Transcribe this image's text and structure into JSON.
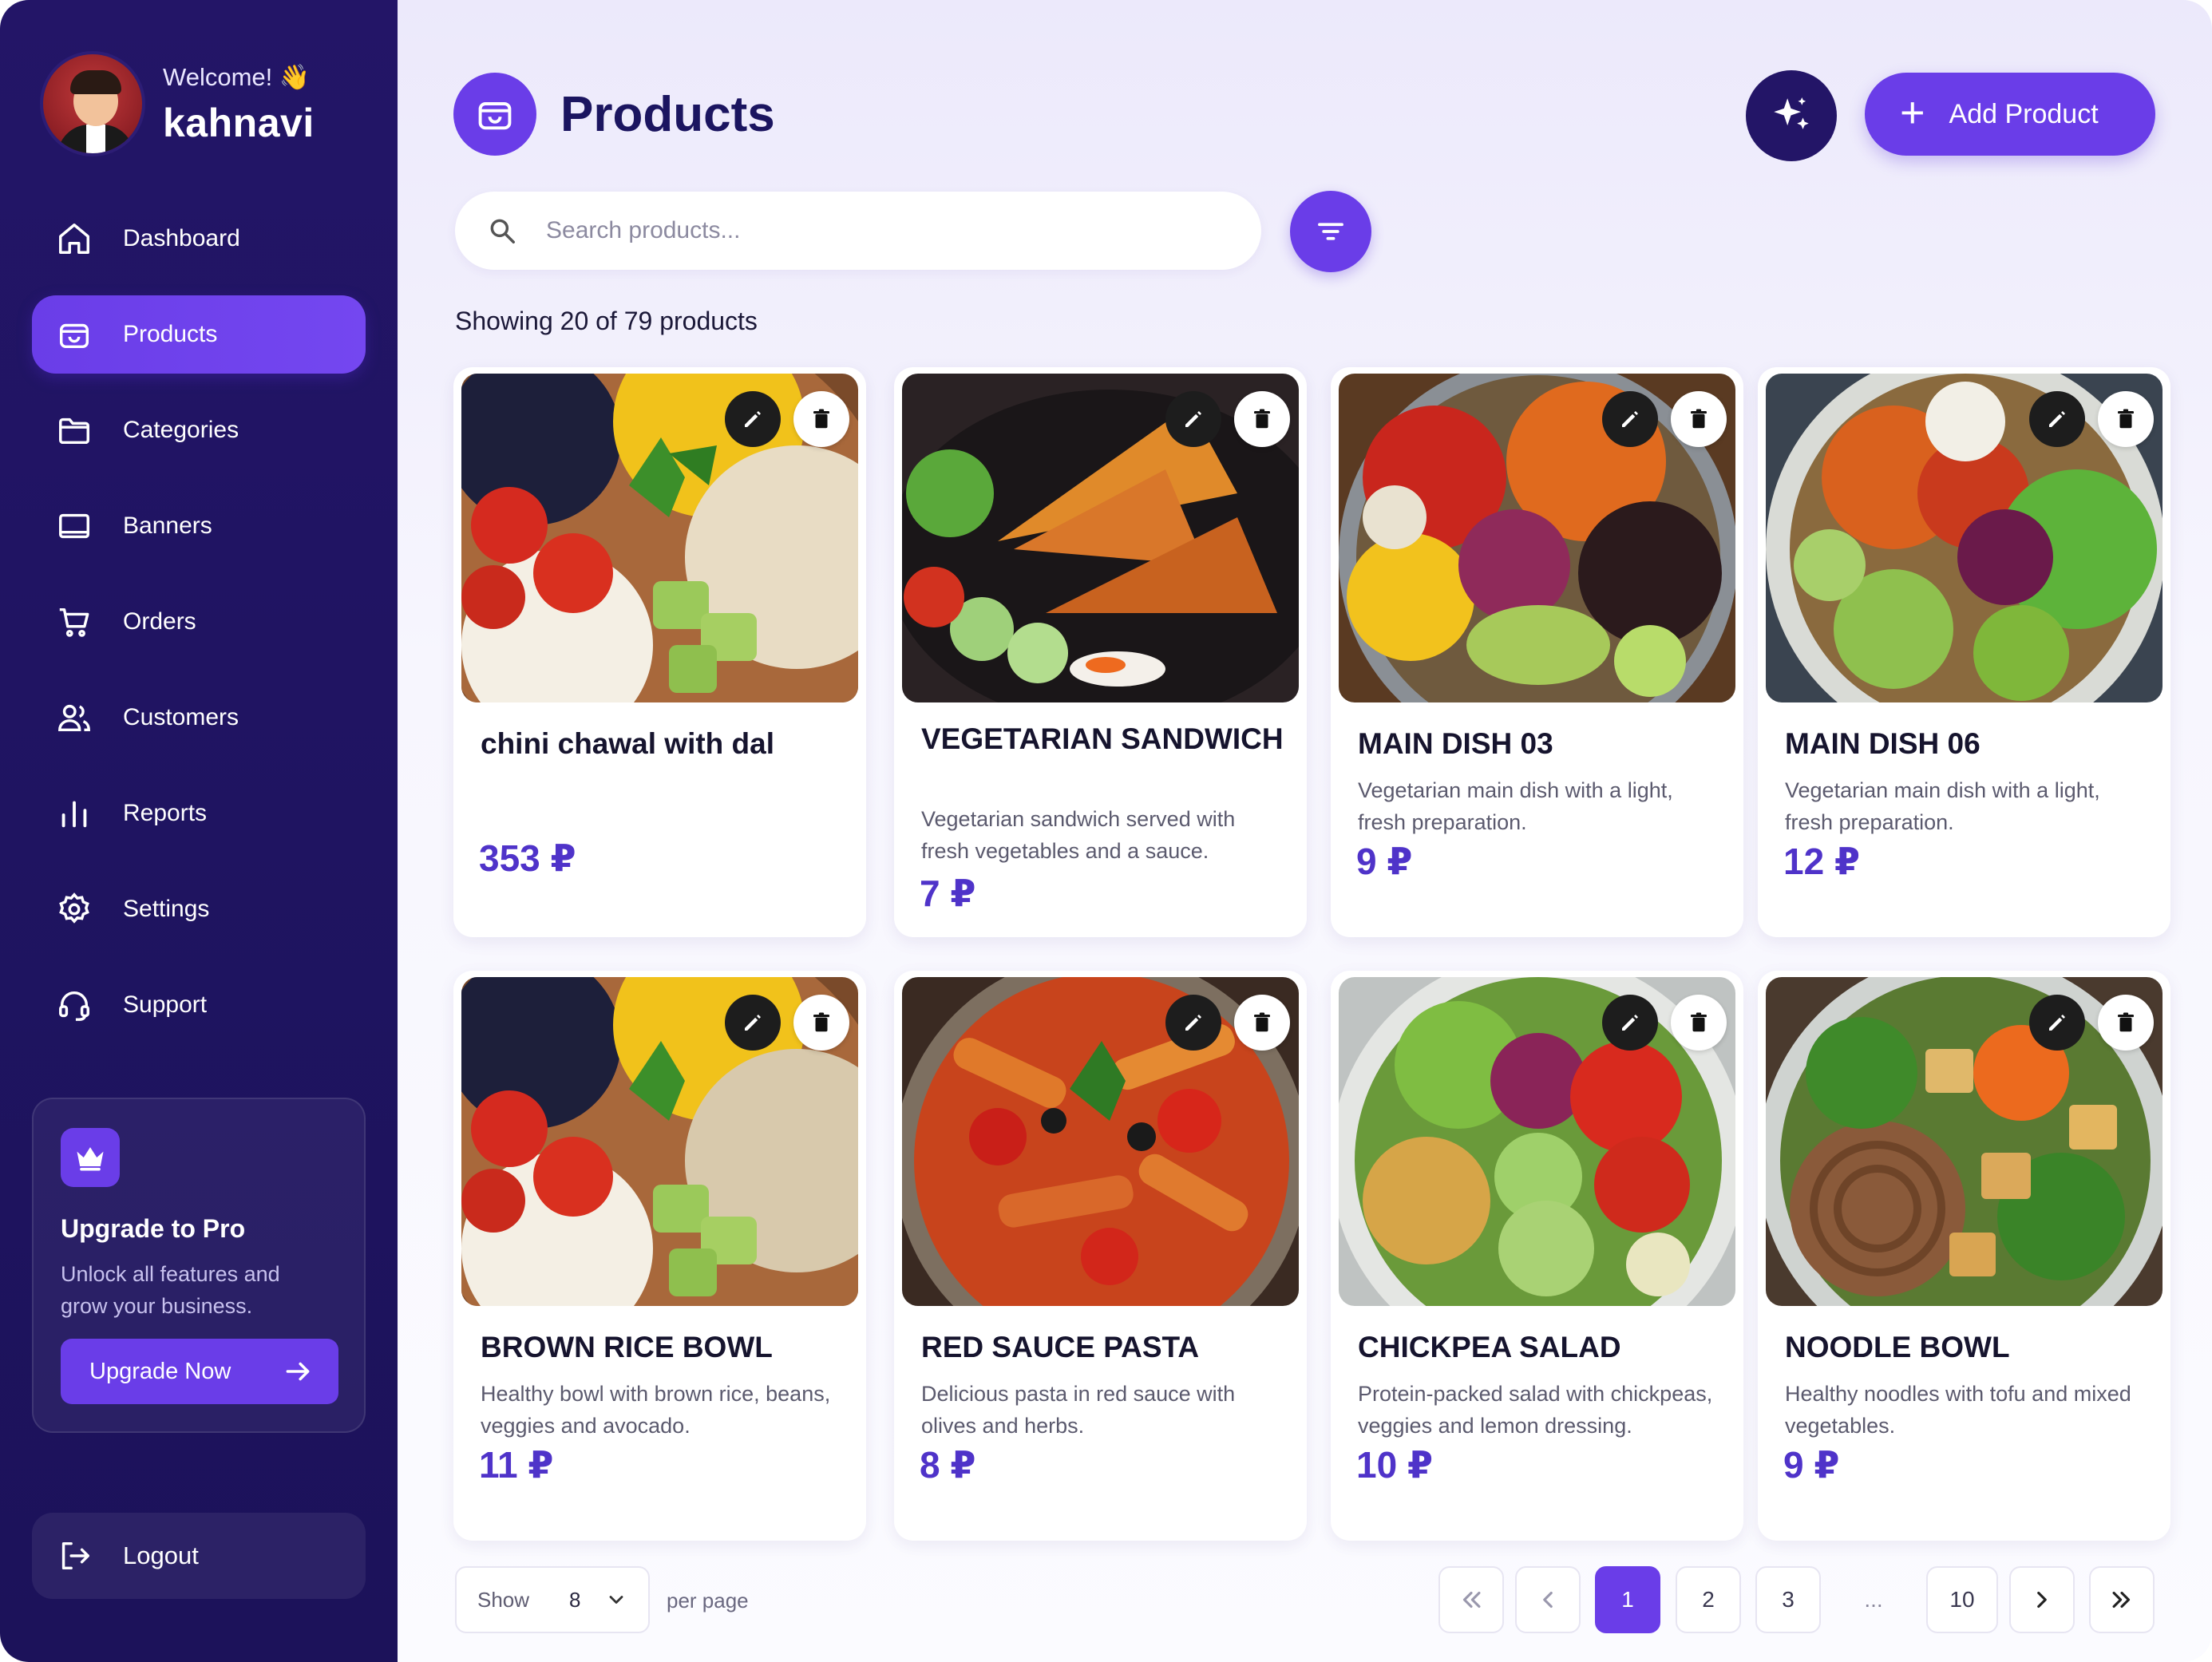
{
  "profile": {
    "welcome": "Welcome! 👋",
    "username": "kahnavi"
  },
  "nav": [
    {
      "label": "Dashboard",
      "icon": "home-icon"
    },
    {
      "label": "Products",
      "icon": "bag-icon",
      "active": true
    },
    {
      "label": "Categories",
      "icon": "folder-icon"
    },
    {
      "label": "Banners",
      "icon": "banner-icon"
    },
    {
      "label": "Orders",
      "icon": "cart-icon"
    },
    {
      "label": "Customers",
      "icon": "users-icon"
    },
    {
      "label": "Reports",
      "icon": "bar-chart-icon"
    },
    {
      "label": "Settings",
      "icon": "gear-icon"
    },
    {
      "label": "Support",
      "icon": "headset-icon"
    }
  ],
  "upgrade": {
    "title": "Upgrade to Pro",
    "subtitle": "Unlock all features and grow your business.",
    "button": "Upgrade Now"
  },
  "logout": "Logout",
  "header": {
    "title": "Products",
    "add_button": "Add Product"
  },
  "search": {
    "placeholder": "Search products...",
    "value": ""
  },
  "showing": "Showing 20 of 79 products",
  "products": [
    {
      "name": "chini chawal with dal",
      "description": "",
      "price": "353 ₽"
    },
    {
      "name": "VEGETARIAN SANDWICH",
      "description": "Vegetarian sandwich served with fresh vegetables and a sauce.",
      "price": "7 ₽"
    },
    {
      "name": "MAIN DISH 03",
      "description": "Vegetarian main dish with a light, fresh preparation.",
      "price": "9 ₽"
    },
    {
      "name": "MAIN DISH 06",
      "description": "Vegetarian main dish with a light, fresh preparation.",
      "price": "12 ₽"
    },
    {
      "name": "BROWN RICE BOWL",
      "description": "Healthy bowl with brown rice, beans, veggies and avocado.",
      "price": "11 ₽"
    },
    {
      "name": "RED SAUCE PASTA",
      "description": "Delicious pasta in red sauce with olives and herbs.",
      "price": "8 ₽"
    },
    {
      "name": "CHICKPEA SALAD",
      "description": "Protein-packed salad with chickpeas, veggies and lemon dressing.",
      "price": "10 ₽"
    },
    {
      "name": "NOODLE BOWL",
      "description": "Healthy noodles with tofu and mixed vegetables.",
      "price": "9 ₽"
    }
  ],
  "pagination": {
    "show_label": "Show",
    "per_page_value": "8",
    "per_page_label": "per page",
    "pages": [
      "1",
      "2",
      "3",
      "...",
      "10"
    ],
    "current": "1"
  },
  "colors": {
    "accent": "#6a3de8",
    "sidebar": "#231567",
    "price": "#4f33c9"
  }
}
